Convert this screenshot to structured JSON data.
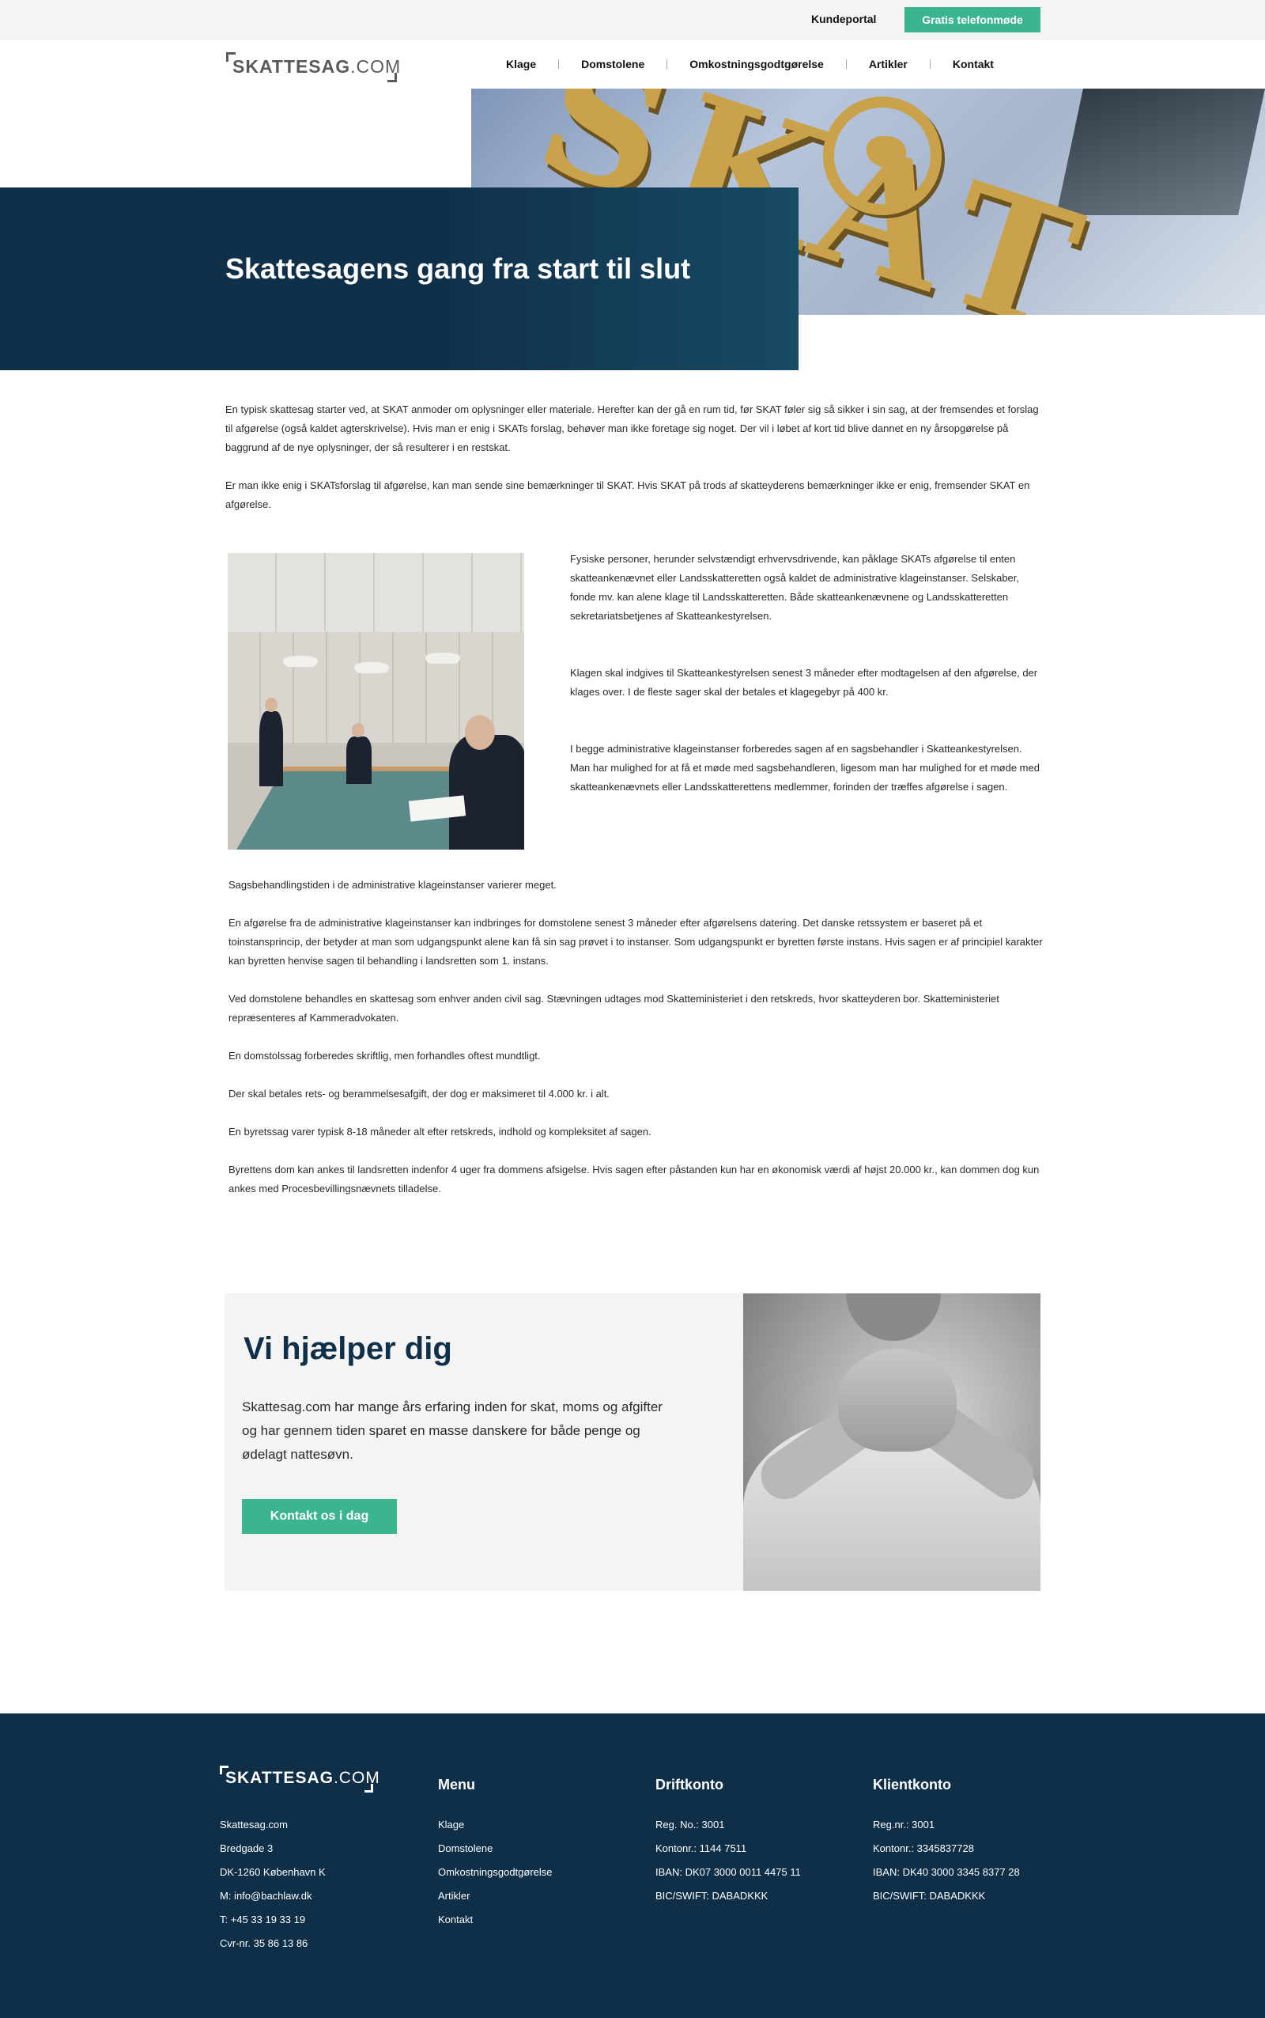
{
  "topbar": {
    "kundeportal": "Kundeportal",
    "cta": "Gratis telefonmøde"
  },
  "header": {
    "logo_bold": "SKATTESAG",
    "logo_light": ".COM",
    "nav": [
      "Klage",
      "Domstolene",
      "Omkostningsgodtgørelse",
      "Artikler",
      "Kontakt"
    ]
  },
  "hero": {
    "title": "Skattesagens gang fra start til slut",
    "image_letters": "SKAT"
  },
  "intro": [
    "En typisk skattesag starter ved, at SKAT anmoder om oplysninger eller materiale. Herefter kan der gå en rum tid, før SKAT føler sig så sikker i sin sag, at der fremsendes et forslag til afgørelse (også kaldet agterskrivelse). Hvis man er enig i SKATs forslag, behøver man ikke foretage sig noget. Der vil i løbet af kort tid blive dannet en ny årsopgørelse på baggrund af de nye oplysninger, der så resulterer i en restskat.",
    "Er man ikke enig i SKATsforslag til afgørelse, kan man sende sine bemærkninger til SKAT. Hvis SKAT på trods af skatteyderens bemærkninger ikke er enig, fremsender SKAT en afgørelse."
  ],
  "right_column": [
    "Fysiske personer, herunder selvstændigt erhvervsdrivende, kan påklage SKATs afgørelse til enten skatteankenævnet eller Landsskatteretten også kaldet de administrative klageinstanser. Selskaber, fonde mv. kan alene klage til Landsskatteretten. Både skatteankenævnene og Landsskatteretten sekretariatsbetjenes af Skatteankestyrelsen.",
    "Klagen skal indgives til Skatteankestyrelsen senest 3 måneder efter modtagelsen af den afgørelse, der klages over. I de fleste sager skal der betales et klagegebyr på 400 kr.",
    "I begge administrative klageinstanser forberedes sagen af en sagsbehandler i Skatteankestyrelsen. Man har mulighed for at få et møde med sagsbehandleren, ligesom man har mulighed for et møde med skatteankenævnets eller Landsskatterettens medlemmer, forinden der træffes afgørelse i sagen."
  ],
  "body": [
    "Sagsbehandlingstiden i de administrative klageinstanser varierer meget.",
    "En afgørelse fra de administrative klageinstanser kan indbringes for domstolene senest 3 måneder efter afgørelsens datering. Det danske retssystem er baseret på et toinstansprincip, der betyder at man som udgangspunkt alene kan få sin sag prøvet i to instanser.  Som udgangspunkt er byretten første instans. Hvis sagen er af principiel karakter kan byretten henvise sagen til behandling i landsretten som 1. instans.",
    "Ved domstolene behandles en skattesag som enhver anden civil sag. Stævningen udtages mod Skatteministeriet i den retskreds, hvor skatteyderen bor. Skatteministeriet repræsenteres af Kammeradvokaten.",
    "En domstolssag forberedes skriftlig, men forhandles oftest mundtligt.",
    "Der skal betales rets- og berammelsesafgift, der dog er maksimeret til 4.000 kr. i alt.",
    "En byretssag varer typisk 8-18 måneder alt efter retskreds, indhold og kompleksitet af sagen.",
    "Byrettens dom kan ankes til landsretten indenfor 4 uger fra dommens afsigelse. Hvis sagen efter påstanden kun har en økonomisk værdi af højst 20.000 kr., kan dommen dog kun ankes med Procesbevillingsnævnets tilladelse."
  ],
  "help": {
    "title": "Vi hjælper dig",
    "text": "Skattesag.com har mange års erfaring inden for skat, moms og afgifter og har gennem tiden sparet en masse danskere for både penge og ødelagt nattesøvn.",
    "button": "Kontakt os i dag"
  },
  "footer": {
    "logo_bold": "SKATTESAG",
    "logo_light": ".COM",
    "contact": [
      "Skattesag.com",
      "Bredgade 3",
      "DK-1260 København K",
      "M: info@bachlaw.dk",
      "T: +45 33 19 33 19",
      "Cvr-nr. 35 86 13 86"
    ],
    "menu_title": "Menu",
    "menu": [
      "Klage",
      "Domstolene",
      "Omkostningsgodtgørelse",
      "Artikler",
      "Kontakt"
    ],
    "drift_title": "Driftkonto",
    "drift": [
      "Reg. No.: 3001",
      "Kontonr.: 1144 7511",
      "IBAN: DK07 3000 0011 4475 11",
      "BIC/SWIFT: DABADKKK"
    ],
    "klient_title": "Klientkonto",
    "klient": [
      "Reg.nr.: 3001",
      "Kontonr.: 3345837728",
      "IBAN: DK40 3000 3345 8377 28",
      "BIC/SWIFT: DABADKKK"
    ]
  },
  "colors": {
    "navy": "#0f2e47",
    "accent_green": "#3bb590",
    "light_gray": "#f4f4f4"
  }
}
